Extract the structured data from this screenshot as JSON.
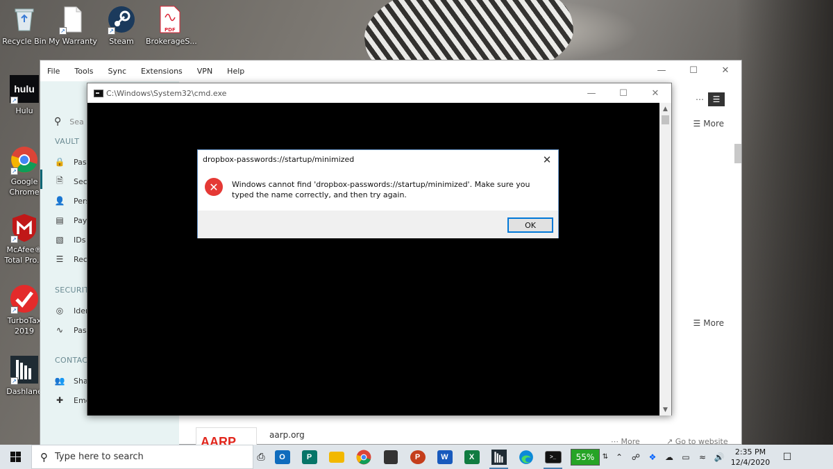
{
  "desktop": {
    "icons": [
      {
        "label": "Recycle Bin"
      },
      {
        "label": "My Warranty"
      },
      {
        "label": "Steam"
      },
      {
        "label": "BrokerageS...",
        "badge": "PDF"
      },
      {
        "label": "Hulu",
        "logo": "hulu"
      },
      {
        "label": "Google Chrome"
      },
      {
        "label": "McAfee® Total Pro..."
      },
      {
        "label": "TurboTax 2019"
      },
      {
        "label": "Dashlane"
      }
    ]
  },
  "dashlane": {
    "menu": [
      "File",
      "Tools",
      "Sync",
      "Extensions",
      "VPN",
      "Help"
    ],
    "search_placeholder": "Sea",
    "sections": {
      "vault": "VAULT",
      "security": "SECURITY",
      "contacts": "CONTACT"
    },
    "vault_items": [
      "Pas",
      "Sec",
      "Pers",
      "Pay",
      "IDs",
      "Rec"
    ],
    "security_items": [
      "Ider",
      "Pas"
    ],
    "contact_items": [
      "Sha",
      "Eme"
    ],
    "more_label_1": "More",
    "more_label_2": "More",
    "bottom_row": {
      "logo_text": "AARP",
      "site": "aarp.org",
      "more": "More",
      "goto": "Go to website"
    }
  },
  "cmd": {
    "title": "C:\\Windows\\System32\\cmd.exe"
  },
  "dialog": {
    "title": "dropbox-passwords://startup/minimized",
    "message": "Windows cannot find 'dropbox-passwords://startup/minimized'. Make sure you typed the name correctly, and then try again.",
    "ok_label": "OK"
  },
  "taskbar": {
    "search_placeholder": "Type here to search",
    "apps": [
      {
        "name": "outlook",
        "letter": "O",
        "color": "#0f6cbd"
      },
      {
        "name": "publisher",
        "letter": "P",
        "color": "#077568"
      },
      {
        "name": "file-explorer",
        "letter": "",
        "color": "#f2b800"
      },
      {
        "name": "chrome",
        "letter": "",
        "color": "#db4437"
      },
      {
        "name": "store",
        "letter": "",
        "color": "#333333"
      },
      {
        "name": "powerpoint",
        "letter": "P",
        "color": "#c43e1c"
      },
      {
        "name": "word",
        "letter": "W",
        "color": "#185abd"
      },
      {
        "name": "excel",
        "letter": "X",
        "color": "#107c41"
      },
      {
        "name": "dashlane",
        "letter": "",
        "color": "#1f2b33"
      },
      {
        "name": "edge",
        "letter": "",
        "color": "#0c8ad8"
      },
      {
        "name": "cmd",
        "letter": "",
        "color": "#111111"
      }
    ],
    "battery": "55%",
    "time": "2:35 PM",
    "date": "12/4/2020"
  }
}
